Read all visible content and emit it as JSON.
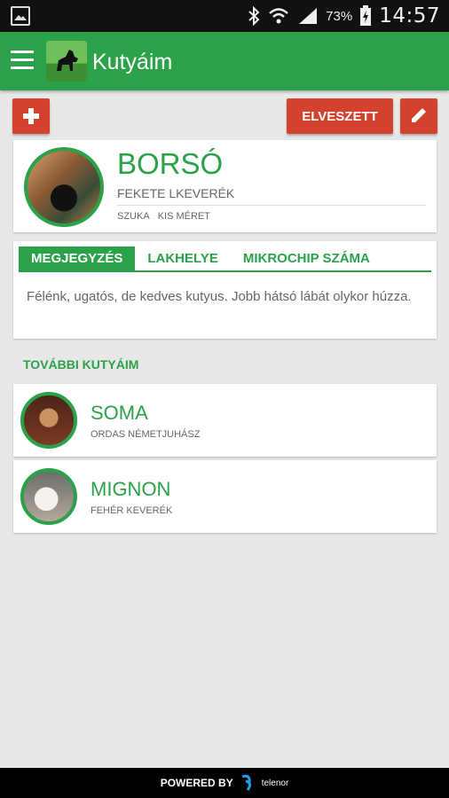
{
  "status_bar": {
    "battery_percent": "73%",
    "time": "14:57"
  },
  "app_bar": {
    "title": "Kutyáim"
  },
  "actions": {
    "lost_label": "ELVESZETT"
  },
  "main_dog": {
    "name": "BORSÓ",
    "breed": "FEKETE LKEVERÉK",
    "sex": "SZUKA",
    "size": "KIS MÉRET"
  },
  "tabs": [
    {
      "label": "MEGJEGYZÉS",
      "active": true
    },
    {
      "label": "LAKHELYE",
      "active": false
    },
    {
      "label": "MIKROCHIP SZÁMA",
      "active": false
    }
  ],
  "note": "Félénk, ugatós, de kedves kutyus. Jobb hátsó lábát olykor húzza.",
  "other_section_title": "TOVÁBBI KUTYÁIM",
  "other_dogs": [
    {
      "name": "SOMA",
      "breed": "ORDAS NÉMETJUHÁSZ"
    },
    {
      "name": "MIGNON",
      "breed": "FEHÉR KEVERÉK"
    }
  ],
  "footer": {
    "powered_by": "POWERED BY",
    "brand": "telenor"
  },
  "colors": {
    "primary": "#2ba14a",
    "accent": "#d4412f"
  }
}
